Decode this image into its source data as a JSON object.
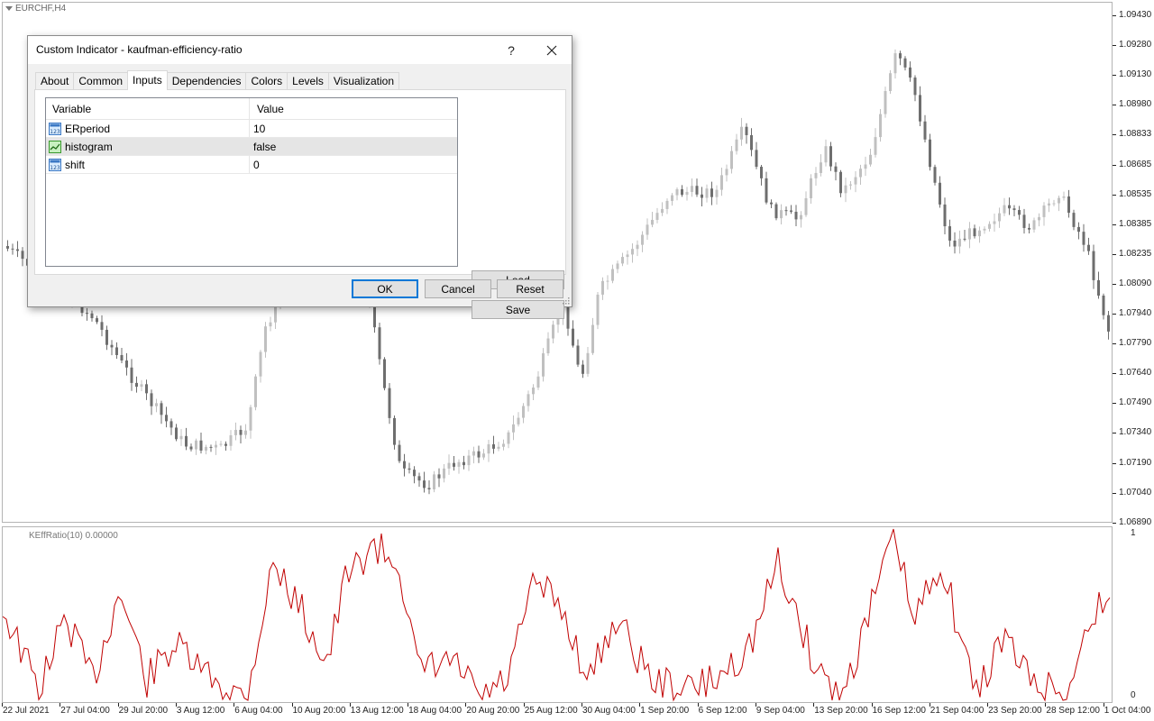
{
  "chart": {
    "symbol_label": "EURCHF,H4",
    "indicator_label": "KEffRatio(10) 0.00000",
    "price_levels": [
      "1.09430",
      "1.09280",
      "1.09130",
      "1.08980",
      "1.08833",
      "1.08685",
      "1.08535",
      "1.08385",
      "1.08235",
      "1.08090",
      "1.07940",
      "1.07790",
      "1.07640",
      "1.07490",
      "1.07340",
      "1.07190",
      "1.07040",
      "1.06890"
    ],
    "indicator_levels": [
      "1",
      "0"
    ],
    "time_labels": [
      "22 Jul 2021",
      "27 Jul 04:00",
      "29 Jul 20:00",
      "3 Aug 12:00",
      "6 Aug 04:00",
      "10 Aug 20:00",
      "13 Aug 12:00",
      "18 Aug 04:00",
      "20 Aug 20:00",
      "25 Aug 12:00",
      "30 Aug 04:00",
      "1 Sep 20:00",
      "6 Sep 12:00",
      "9 Sep 04:00",
      "13 Sep 20:00",
      "16 Sep 12:00",
      "21 Sep 04:00",
      "23 Sep 20:00",
      "28 Sep 12:00",
      "1 Oct 04:00"
    ],
    "colors": {
      "bull": "#c0c0c0",
      "bear": "#6e6e6e",
      "indicator_line": "#c00000"
    }
  },
  "dialog": {
    "title": "Custom Indicator - kaufman-efficiency-ratio",
    "help_label": "?",
    "close_label": "✕",
    "tabs": [
      {
        "label": "About"
      },
      {
        "label": "Common"
      },
      {
        "label": "Inputs"
      },
      {
        "label": "Dependencies"
      },
      {
        "label": "Colors"
      },
      {
        "label": "Levels"
      },
      {
        "label": "Visualization"
      }
    ],
    "active_tab": "Inputs",
    "table": {
      "headers": {
        "variable": "Variable",
        "value": "Value"
      },
      "rows": [
        {
          "variable": "ERperiod",
          "value": "10",
          "icon": "integer-icon"
        },
        {
          "variable": "histogram",
          "value": "false",
          "icon": "boolean-icon"
        },
        {
          "variable": "shift",
          "value": "0",
          "icon": "integer-icon"
        }
      ],
      "selected_row": 1
    },
    "buttons": {
      "load": "Load",
      "save": "Save",
      "ok": "OK",
      "cancel": "Cancel",
      "reset": "Reset"
    }
  }
}
